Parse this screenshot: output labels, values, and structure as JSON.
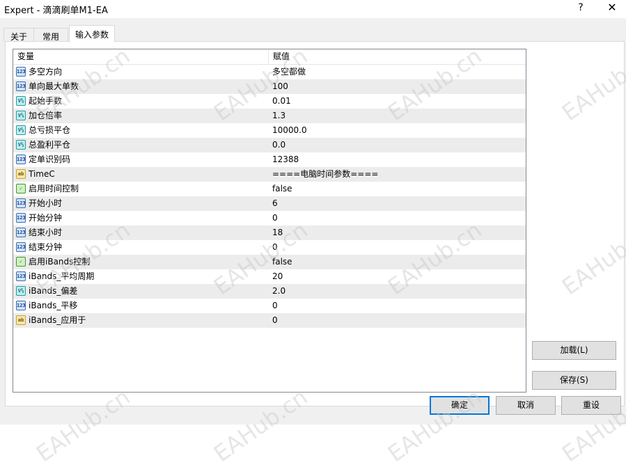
{
  "window": {
    "title": "Expert - 滴滴刷单M1-EA",
    "help_label": "?",
    "close_label": "✕"
  },
  "tabs": [
    {
      "label": "关于",
      "active": false
    },
    {
      "label": "常用",
      "active": false
    },
    {
      "label": "输入参数",
      "active": true
    }
  ],
  "grid": {
    "columns": [
      "变量",
      "赋值"
    ],
    "rows": [
      {
        "type": "int",
        "icon_text": "123",
        "name": "多空方向",
        "value": "多空都做"
      },
      {
        "type": "int",
        "icon_text": "123",
        "name": "单向最大单数",
        "value": "100"
      },
      {
        "type": "dbl",
        "icon_text": "V⅔",
        "name": "起始手数",
        "value": "0.01"
      },
      {
        "type": "dbl",
        "icon_text": "V⅔",
        "name": "加仓倍率",
        "value": "1.3"
      },
      {
        "type": "dbl",
        "icon_text": "V⅔",
        "name": "总亏损平仓",
        "value": "10000.0"
      },
      {
        "type": "dbl",
        "icon_text": "V⅔",
        "name": "总盈利平仓",
        "value": "0.0"
      },
      {
        "type": "int",
        "icon_text": "123",
        "name": "定单识别码",
        "value": "12388"
      },
      {
        "type": "str",
        "icon_text": "ab",
        "name": "TimeC",
        "value": "====电脑时间参数===="
      },
      {
        "type": "bool",
        "icon_text": "✓",
        "name": "启用时间控制",
        "value": "false"
      },
      {
        "type": "int",
        "icon_text": "123",
        "name": "开始小时",
        "value": "6"
      },
      {
        "type": "int",
        "icon_text": "123",
        "name": "开始分钟",
        "value": "0"
      },
      {
        "type": "int",
        "icon_text": "123",
        "name": "结束小时",
        "value": "18"
      },
      {
        "type": "int",
        "icon_text": "123",
        "name": "结束分钟",
        "value": "0"
      },
      {
        "type": "bool",
        "icon_text": "✓",
        "name": "启用iBands控制",
        "value": "false"
      },
      {
        "type": "int",
        "icon_text": "123",
        "name": "iBands_平均周期",
        "value": "20"
      },
      {
        "type": "dbl",
        "icon_text": "V⅔",
        "name": "iBands_偏差",
        "value": "2.0"
      },
      {
        "type": "int",
        "icon_text": "123",
        "name": "iBands_平移",
        "value": "0"
      },
      {
        "type": "str",
        "icon_text": "ab",
        "name": "iBands_应用于",
        "value": "0"
      }
    ]
  },
  "buttons": {
    "load": "加载(L)",
    "save": "保存(S)",
    "ok": "确定",
    "cancel": "取消",
    "reset": "重设"
  },
  "watermark": "EAHub.cn"
}
